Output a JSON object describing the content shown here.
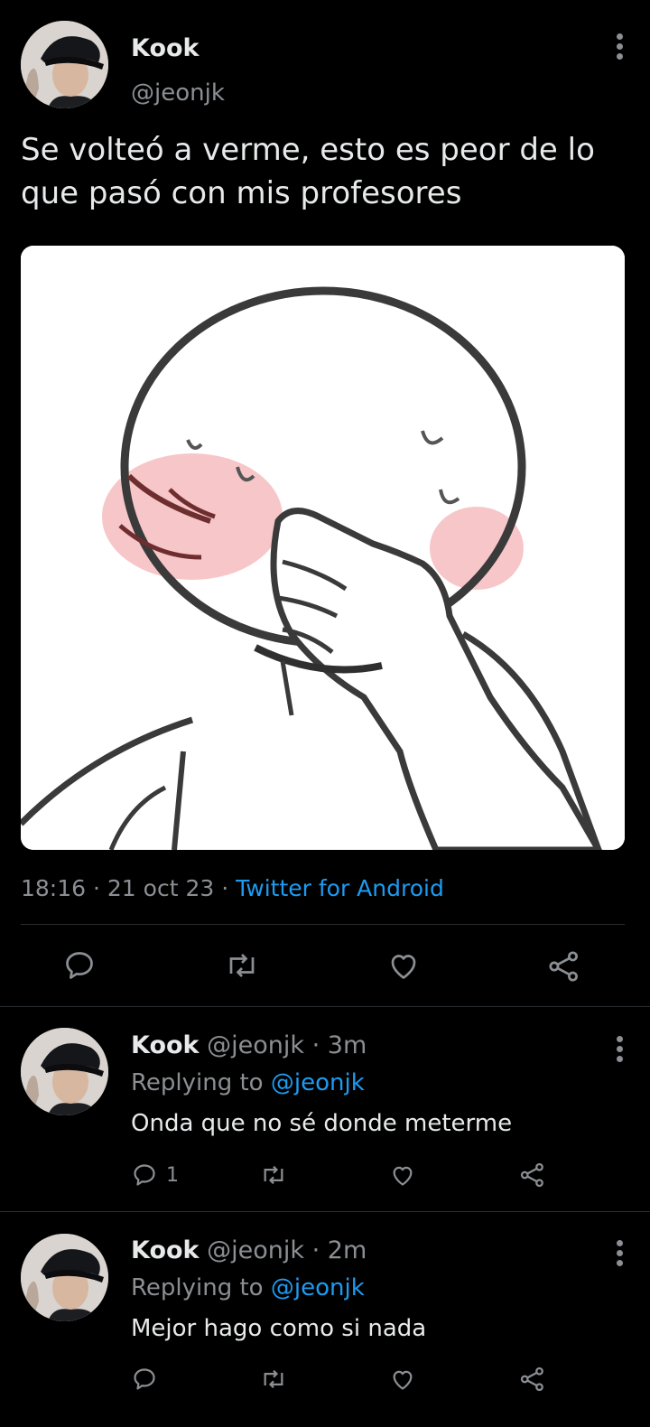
{
  "tweet": {
    "author_name": "Kook",
    "author_handle": "@jeonjk",
    "text_line1": "Se volteó a verme, esto es peor de lo",
    "text_line2": "que pasó con mis profesores",
    "time": "18:16",
    "date": "21 oct 23",
    "dot": "·",
    "source": "Twitter for Android",
    "image_description": "drawing of a blushing character covering its face with a hand"
  },
  "replies": [
    {
      "author_name": "Kook",
      "author_handle": "@jeonjk",
      "age": "3m",
      "replying_prefix": "Replying to",
      "replying_handle": "@jeonjk",
      "text": "Onda que no sé donde meterme",
      "reply_count": "1"
    },
    {
      "author_name": "Kook",
      "author_handle": "@jeonjk",
      "age": "2m",
      "replying_prefix": "Replying to",
      "replying_handle": "@jeonjk",
      "text": "Mejor hago como si nada",
      "reply_count": ""
    }
  ],
  "icons": {
    "reply": "speech-bubble-icon",
    "retweet": "retweet-icon",
    "like": "heart-icon",
    "share": "share-icon",
    "more": "vertical-dots-icon"
  },
  "colors": {
    "background": "#000000",
    "text": "#e7e9ea",
    "muted": "#8b8f93",
    "link": "#1d9bf0"
  }
}
